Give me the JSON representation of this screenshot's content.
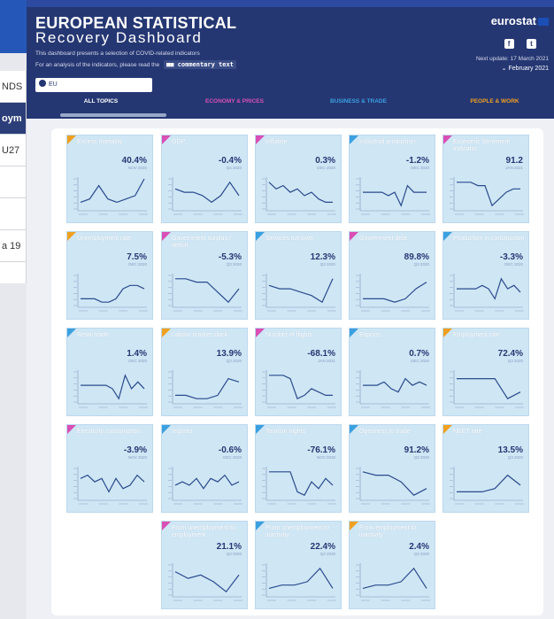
{
  "background": {
    "strip_rows": [
      "NDS",
      "oym",
      "U27",
      "",
      "",
      "a 19"
    ]
  },
  "header": {
    "title": "EUROPEAN STATISTICAL",
    "subtitle": "Recovery Dashboard",
    "desc1": "This dashboard presents a selection of COVID-related indicators",
    "desc2": "For an analysis of the indicators, please read the",
    "commentary": "commentary text",
    "brand": "eurostat",
    "next_update_label": "Next update: 17 March 2021",
    "next_update_date": "February 2021",
    "selector_value": "EU",
    "tabs": [
      {
        "label": "ALL TOPICS",
        "color": "#ffffff"
      },
      {
        "label": "ECONOMY & PRICES",
        "color": "#d94fb5"
      },
      {
        "label": "BUSINESS & TRADE",
        "color": "#3ba0e0"
      },
      {
        "label": "PEOPLE & WORK",
        "color": "#f0a020"
      }
    ]
  },
  "colors": {
    "economy": "#d94fb5",
    "business": "#3ba0e0",
    "people": "#f0a020",
    "line": "#2a4a8c"
  },
  "cards": [
    {
      "title": "Excess mortality",
      "value": "40.4%",
      "period": "NOV 2020",
      "topic": "people",
      "trend": [
        2,
        3,
        7,
        3,
        2,
        3,
        4,
        9
      ]
    },
    {
      "title": "GDP",
      "value": "-0.4%",
      "period": "Q4 2020",
      "topic": "economy",
      "trend": [
        6,
        5,
        5,
        4,
        2,
        4,
        8,
        4
      ]
    },
    {
      "title": "Inflation",
      "value": "0.3%",
      "period": "DEC 2020",
      "topic": "economy",
      "trend": [
        8,
        6,
        7,
        5,
        6,
        4,
        5,
        3,
        2,
        2
      ]
    },
    {
      "title": "Industrial production",
      "value": "-1.2%",
      "period": "DEC 2020",
      "topic": "business",
      "trend": [
        5,
        5,
        5,
        5,
        4,
        5,
        1,
        7,
        5,
        5,
        5
      ]
    },
    {
      "title": "Economic Sentiment Indicator",
      "value": "91.2",
      "period": "JAN 2021",
      "topic": "economy",
      "trend": [
        8,
        8,
        8,
        7,
        7,
        1,
        3,
        5,
        6,
        6
      ]
    },
    {
      "title": "Unemployment rate",
      "value": "7.5%",
      "period": "DEC 2020",
      "topic": "people",
      "trend": [
        2,
        2,
        2,
        1,
        1,
        2,
        5,
        6,
        6,
        5
      ]
    },
    {
      "title": "Government surplus / deficit",
      "value": "-5.3%",
      "period": "Q3 2020",
      "topic": "economy",
      "trend": [
        8,
        8,
        7,
        7,
        4,
        1,
        5
      ]
    },
    {
      "title": "Services turnover",
      "value": "12.3%",
      "period": "Q3 2020",
      "topic": "business",
      "trend": [
        6,
        5,
        5,
        4,
        3,
        1,
        8
      ]
    },
    {
      "title": "Government debt",
      "value": "89.8%",
      "period": "Q3 2020",
      "topic": "economy",
      "trend": [
        2,
        2,
        2,
        1,
        2,
        5,
        7
      ]
    },
    {
      "title": "Production in construction",
      "value": "-3.3%",
      "period": "DEC 2020",
      "topic": "business",
      "trend": [
        5,
        5,
        5,
        5,
        6,
        5,
        2,
        8,
        5,
        6,
        4
      ]
    },
    {
      "title": "Retail trade",
      "value": "1.4%",
      "period": "DEC 2020",
      "topic": "business",
      "trend": [
        5,
        5,
        5,
        5,
        5,
        4,
        1,
        8,
        4,
        6,
        4
      ]
    },
    {
      "title": "Labour market slack",
      "value": "13.9%",
      "period": "Q3 2020",
      "topic": "people",
      "trend": [
        2,
        2,
        1,
        1,
        2,
        7,
        6
      ]
    },
    {
      "title": "Number of flights",
      "value": "-68.1%",
      "period": "JAN 2021",
      "topic": "economy",
      "trend": [
        8,
        8,
        8,
        7,
        1,
        2,
        4,
        3,
        2,
        2
      ]
    },
    {
      "title": "Exports",
      "value": "0.7%",
      "period": "DEC 2020",
      "topic": "business",
      "trend": [
        5,
        5,
        5,
        6,
        4,
        3,
        7,
        5,
        6,
        5
      ]
    },
    {
      "title": "Employment rate",
      "value": "72.4%",
      "period": "Q3 2020",
      "topic": "people",
      "trend": [
        7,
        7,
        7,
        7,
        1,
        3
      ]
    },
    {
      "title": "Electricity consumption",
      "value": "-3.9%",
      "period": "NOV 2020",
      "topic": "economy",
      "trend": [
        6,
        7,
        5,
        6,
        2,
        6,
        3,
        4,
        7,
        5
      ]
    },
    {
      "title": "Imports",
      "value": "-0.6%",
      "period": "DEC 2020",
      "topic": "business",
      "trend": [
        4,
        5,
        4,
        6,
        3,
        6,
        5,
        7,
        4,
        5
      ]
    },
    {
      "title": "Tourism nights",
      "value": "-76.1%",
      "period": "NOV 2020",
      "topic": "business",
      "trend": [
        8,
        8,
        8,
        8,
        2,
        1,
        5,
        3,
        6,
        4
      ]
    },
    {
      "title": "Openness to trade",
      "value": "91.2%",
      "period": "Q3 2020",
      "topic": "business",
      "trend": [
        8,
        7,
        7,
        5,
        1,
        3
      ]
    },
    {
      "title": "NEET rate",
      "value": "13.5%",
      "period": "Q3 2020",
      "topic": "people",
      "trend": [
        2,
        2,
        2,
        3,
        7,
        4
      ]
    },
    {
      "title": "From unemployment to employment",
      "value": "21.1%",
      "period": "Q3 2020",
      "topic": "economy",
      "trend": [
        7,
        5,
        6,
        4,
        1,
        6
      ]
    },
    {
      "title": "From unemployment to inactivity",
      "value": "22.4%",
      "period": "Q3 2020",
      "topic": "business",
      "trend": [
        2,
        3,
        3,
        4,
        8,
        2
      ]
    },
    {
      "title": "From employment to inactivity",
      "value": "2.4%",
      "period": "Q3 2020",
      "topic": "people",
      "trend": [
        2,
        3,
        3,
        4,
        8,
        2
      ]
    }
  ]
}
